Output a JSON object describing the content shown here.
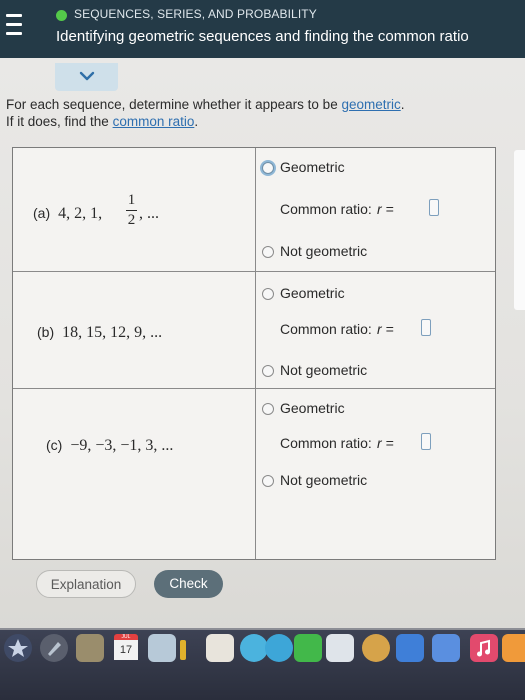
{
  "header": {
    "topic": "SEQUENCES, SERIES, AND PROBABILITY",
    "title": "Identifying geometric sequences and finding the common ratio"
  },
  "instructions": {
    "line1_text": "For each sequence, determine whether it appears to be ",
    "line1_link": "geometric",
    "line1_end": ".",
    "line2_text": "If it does, find the ",
    "line2_link": "common ratio",
    "line2_end": "."
  },
  "rows": [
    {
      "label": "(a)",
      "sequence_prefix": "4, 2, 1,",
      "fraction_num": "1",
      "fraction_den": "2",
      "sequence_suffix": ", ...",
      "option_geometric": "Geometric",
      "common_ratio_label": "Common ratio:",
      "ratio_var": "r =",
      "option_not": "Not geometric"
    },
    {
      "label": "(b)",
      "sequence": "18, 15, 12, 9, ...",
      "option_geometric": "Geometric",
      "common_ratio_label": "Common ratio:",
      "ratio_var": "r =",
      "option_not": "Not geometric"
    },
    {
      "label": "(c)",
      "sequence": "−9, −3, −1, 3, ...",
      "option_geometric": "Geometric",
      "common_ratio_label": "Common ratio:",
      "ratio_var": "r =",
      "option_not": "Not geometric"
    }
  ],
  "buttons": {
    "explanation": "Explanation",
    "check": "Check"
  },
  "dock": {
    "calendar_month": "JUL",
    "calendar_day": "17"
  },
  "colors": {
    "header_bg": "#243a47",
    "topic_dot": "#54c94a",
    "link": "#2e6fb0",
    "check_button": "#5c6f79"
  }
}
